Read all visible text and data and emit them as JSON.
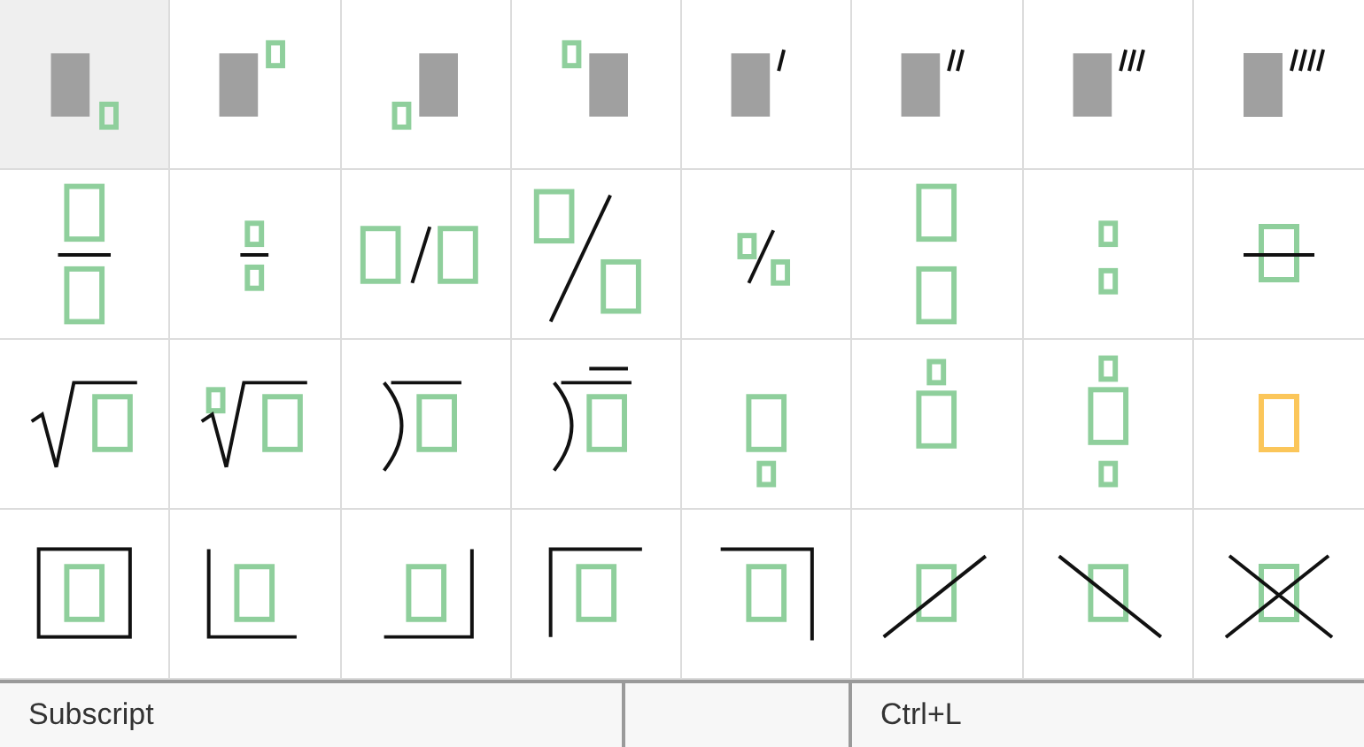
{
  "rows": [
    {
      "cells": [
        {
          "kind": "subscript",
          "selected": true
        },
        {
          "kind": "superscript",
          "selected": false
        },
        {
          "kind": "pre-subscript",
          "selected": false
        },
        {
          "kind": "pre-superscript",
          "selected": false
        },
        {
          "kind": "prime",
          "selected": false
        },
        {
          "kind": "double-prime",
          "selected": false
        },
        {
          "kind": "triple-prime",
          "selected": false
        },
        {
          "kind": "quadruple-prime",
          "selected": false
        }
      ]
    },
    {
      "cells": [
        {
          "kind": "fraction",
          "selected": false
        },
        {
          "kind": "small-fraction",
          "selected": false
        },
        {
          "kind": "slash-fraction",
          "selected": false
        },
        {
          "kind": "diagonal-fraction",
          "selected": false
        },
        {
          "kind": "small-slash-fraction",
          "selected": false
        },
        {
          "kind": "stack",
          "selected": false
        },
        {
          "kind": "small-stack",
          "selected": false
        },
        {
          "kind": "strikethrough",
          "selected": false
        }
      ]
    },
    {
      "cells": [
        {
          "kind": "square-root",
          "selected": false
        },
        {
          "kind": "nth-root",
          "selected": false
        },
        {
          "kind": "long-division",
          "selected": false
        },
        {
          "kind": "long-division-overline",
          "selected": false
        },
        {
          "kind": "underscript",
          "selected": false
        },
        {
          "kind": "overscript",
          "selected": false
        },
        {
          "kind": "over-under",
          "selected": false
        },
        {
          "kind": "placeholder",
          "selected": false
        }
      ]
    },
    {
      "cells": [
        {
          "kind": "box",
          "selected": false
        },
        {
          "kind": "left-bottom-border",
          "selected": false
        },
        {
          "kind": "right-bottom-border",
          "selected": false
        },
        {
          "kind": "left-top-border",
          "selected": false
        },
        {
          "kind": "right-top-border",
          "selected": false
        },
        {
          "kind": "up-strike",
          "selected": false
        },
        {
          "kind": "down-strike",
          "selected": false
        },
        {
          "kind": "cross-strike",
          "selected": false
        }
      ]
    }
  ],
  "status_bar": {
    "description": "Subscript",
    "shortcut": "Ctrl+L"
  }
}
